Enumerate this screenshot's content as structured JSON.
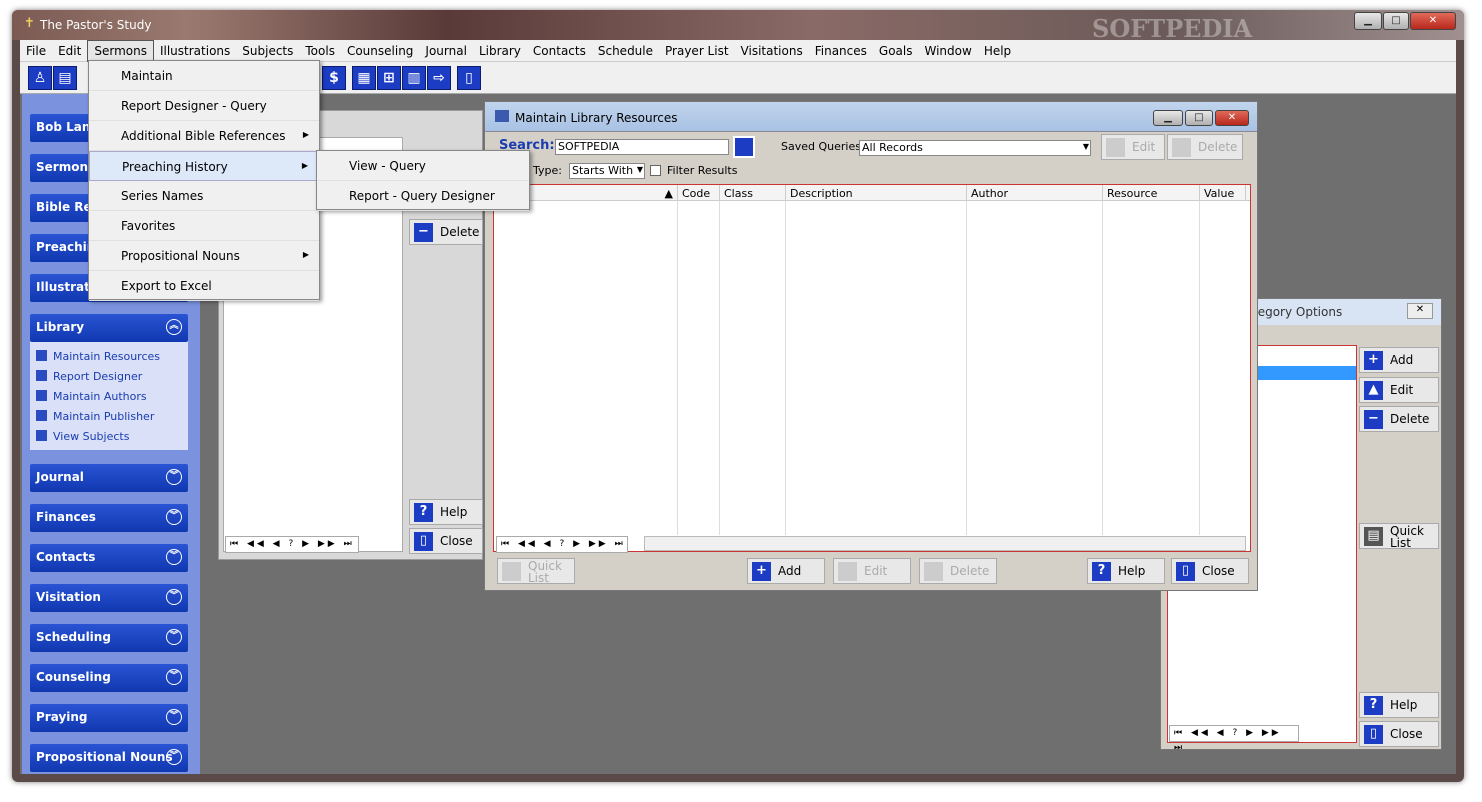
{
  "app": {
    "title": "The Pastor's Study",
    "watermark": "SOFTPEDIA"
  },
  "menubar": [
    "File",
    "Edit",
    "Sermons",
    "Illustrations",
    "Subjects",
    "Tools",
    "Counseling",
    "Journal",
    "Library",
    "Contacts",
    "Schedule",
    "Prayer List",
    "Visitations",
    "Finances",
    "Goals",
    "Window",
    "Help"
  ],
  "sermons_menu": {
    "items": [
      "Maintain",
      "Report Designer - Query",
      "Additional Bible References",
      "Preaching History",
      "Series Names",
      "Favorites",
      "Propositional Nouns",
      "Export to Excel"
    ]
  },
  "preaching_submenu": {
    "items": [
      "View - Query",
      "Report - Query Designer"
    ]
  },
  "sidebar": {
    "top": [
      "Bob Lane",
      "Sermons",
      "Bible Ref",
      "Preachin",
      "Illustratio"
    ],
    "library": {
      "title": "Library",
      "items": [
        "Maintain Resources",
        "Report Designer",
        "Maintain Authors",
        "Maintain Publisher",
        "View Subjects"
      ]
    },
    "groups": [
      "Journal",
      "Finances",
      "Contacts",
      "Visitation",
      "Scheduling",
      "Counseling",
      "Praying",
      "Propositional Nouns"
    ]
  },
  "bgwin": {
    "delete": "Delete",
    "help": "Help",
    "close": "Close"
  },
  "library_win": {
    "title": "Maintain Library Resources",
    "search_label": "Search:",
    "search_value": "SOFTPEDIA",
    "type_label": "r Type:",
    "type_value": "Starts With",
    "filter_label": "Filter Results",
    "saved_label": "Saved Queries:",
    "saved_value": "All Records",
    "edit": "Edit",
    "delete": "Delete",
    "columns": [
      "Code",
      "Class",
      "Description",
      "Author",
      "Resource",
      "Value"
    ],
    "bottom": {
      "quick": "Quick List",
      "add": "Add",
      "edit": "Edit",
      "delete": "Delete",
      "help": "Help",
      "close": "Close"
    }
  },
  "category_win": {
    "title": "tegory Options",
    "add": "Add",
    "edit": "Edit",
    "delete": "Delete",
    "quick": "Quick List",
    "help": "Help",
    "close": "Close"
  },
  "nav_glyphs": "⏮ ◀◀ ◀ ? ▶ ▶▶ ⏭"
}
